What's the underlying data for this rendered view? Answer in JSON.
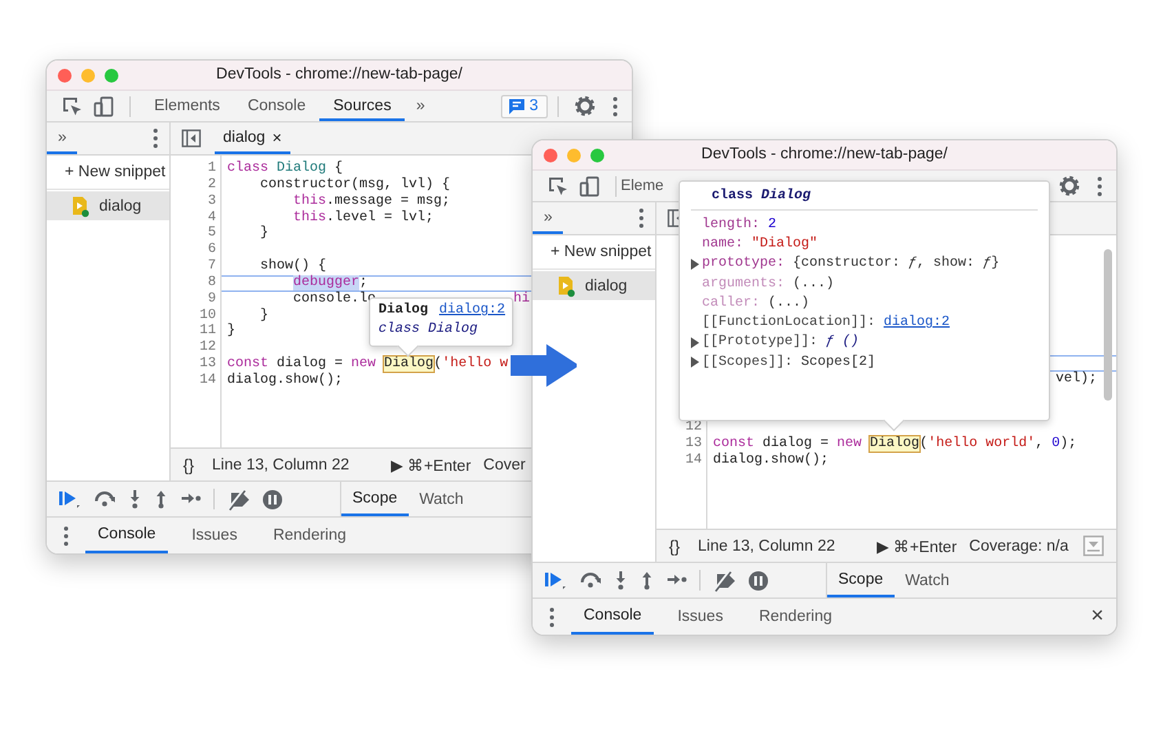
{
  "windows": [
    {
      "title": "DevTools - chrome://new-tab-page/",
      "toolbar": {
        "tabs": [
          {
            "label": "Elements",
            "selected": false
          },
          {
            "label": "Console",
            "selected": false
          },
          {
            "label": "Sources",
            "selected": true
          }
        ],
        "more": "»",
        "issues_badge": "3"
      },
      "navigator": {
        "tabs": [
          {
            "label": "»",
            "selected": true
          }
        ],
        "new_snippet": "+ New snippet",
        "files": [
          {
            "name": "dialog",
            "selected": true
          }
        ]
      },
      "editor_tabs": [
        {
          "label": "dialog",
          "selected": true,
          "close": "×"
        }
      ],
      "code_lines": [
        {
          "number": "1",
          "highlighted": false,
          "tokens": [
            {
              "text": "class",
              "kind": "keyword"
            },
            {
              "text": " Dialog",
              "kind": "class"
            },
            {
              "text": " {",
              "kind": "plain"
            }
          ]
        },
        {
          "number": "2",
          "highlighted": false,
          "tokens": [
            {
              "text": "    constructor(msg, lvl) {",
              "kind": "plain"
            }
          ]
        },
        {
          "number": "3",
          "highlighted": false,
          "tokens": [
            {
              "text": "        this",
              "kind": "keyword"
            },
            {
              "text": ".message = msg;",
              "kind": "plain"
            }
          ]
        },
        {
          "number": "4",
          "highlighted": false,
          "tokens": [
            {
              "text": "        this",
              "kind": "keyword"
            },
            {
              "text": ".level = lvl;",
              "kind": "plain"
            }
          ]
        },
        {
          "number": "5",
          "highlighted": false,
          "tokens": [
            {
              "text": "    }",
              "kind": "plain"
            }
          ]
        },
        {
          "number": "6",
          "highlighted": false
        },
        {
          "number": "7",
          "highlighted": false,
          "tokens": [
            {
              "text": "    show() {",
              "kind": "plain"
            }
          ]
        },
        {
          "number": "8",
          "highlighted": true,
          "tokens": [
            {
              "text": "        debugger",
              "kind": "selection"
            },
            {
              "text": ";",
              "kind": "plain"
            }
          ]
        },
        {
          "number": "9",
          "highlighted": false,
          "tokens": [
            {
              "text": "        console.lo",
              "kind": "plain"
            },
            {
              "text": "hi",
              "kind": "keyword",
              "after_covered": true
            }
          ]
        },
        {
          "number": "10",
          "highlighted": false,
          "tokens": [
            {
              "text": "    }",
              "kind": "plain"
            }
          ]
        },
        {
          "number": "11",
          "highlighted": false,
          "tokens": [
            {
              "text": "}",
              "kind": "plain"
            }
          ]
        },
        {
          "number": "12",
          "highlighted": false
        },
        {
          "number": "13",
          "highlighted": false,
          "tokens": [
            {
              "text": "const",
              "kind": "keyword"
            },
            {
              "text": " dialog = ",
              "kind": "plain"
            },
            {
              "text": "new ",
              "kind": "keyword"
            },
            {
              "text": "Dialog",
              "kind": "hover"
            },
            {
              "text": "(",
              "kind": "plain"
            },
            {
              "text": "'hello w",
              "kind": "string"
            }
          ]
        },
        {
          "number": "14",
          "highlighted": false,
          "tokens": [
            {
              "text": "dialog.show();",
              "kind": "plain"
            }
          ]
        }
      ],
      "status": {
        "format": "{}",
        "position": "Line 13, Column 22",
        "run": "▶ ⌘+Enter",
        "coverage": "Cover"
      },
      "debugger": {
        "tabs": [
          {
            "label": "Scope",
            "selected": true
          },
          {
            "label": "Watch",
            "selected": false
          }
        ]
      },
      "drawer": {
        "tabs": [
          {
            "label": "Console",
            "selected": true
          },
          {
            "label": "Issues",
            "selected": false
          },
          {
            "label": "Rendering",
            "selected": false
          }
        ]
      },
      "popover": {
        "kind": "brief",
        "title": "Dialog",
        "link": "dialog:2",
        "subtitle": "class Dialog"
      }
    },
    {
      "title": "DevTools - chrome://new-tab-page/",
      "toolbar": {
        "tabs": [
          {
            "label": "Eleme",
            "selected": false
          }
        ]
      },
      "navigator": {
        "tabs": [
          {
            "label": "»",
            "selected": true
          }
        ],
        "new_snippet": "+ New snippet",
        "files": [
          {
            "name": "dialog",
            "selected": true
          }
        ]
      },
      "code_lines": [
        {
          "highlighted": false
        },
        {
          "highlighted": false
        },
        {
          "highlighted": false
        },
        {
          "highlighted": false
        },
        {
          "highlighted": false
        },
        {
          "highlighted": false
        },
        {
          "highlighted": false
        },
        {
          "highlighted": true
        },
        {
          "highlighted": false,
          "tokens": [
            {
              "text": "vel);",
              "kind": "plain",
              "after_covered": true
            }
          ]
        },
        {
          "highlighted": false
        },
        {
          "highlighted": false
        },
        {
          "number": "12",
          "highlighted": false
        },
        {
          "number": "13",
          "highlighted": false,
          "tokens": [
            {
              "text": "const",
              "kind": "keyword"
            },
            {
              "text": " dialog = ",
              "kind": "plain"
            },
            {
              "text": "new ",
              "kind": "keyword"
            },
            {
              "text": "Dialog",
              "kind": "hover"
            },
            {
              "text": "(",
              "kind": "plain"
            },
            {
              "text": "'hello world'",
              "kind": "string"
            },
            {
              "text": ", ",
              "kind": "plain"
            },
            {
              "text": "0",
              "kind": "number"
            },
            {
              "text": ");",
              "kind": "plain"
            }
          ]
        },
        {
          "number": "14",
          "highlighted": false,
          "tokens": [
            {
              "text": "dialog.show();",
              "kind": "plain"
            }
          ]
        }
      ],
      "scrollbar": true,
      "status": {
        "format": "{}",
        "position": "Line 13, Column 22",
        "run": "▶ ⌘+Enter",
        "coverage": "Coverage: n/a",
        "panel_icon": true
      },
      "debugger": {
        "tabs": [
          {
            "label": "Scope",
            "selected": true
          },
          {
            "label": "Watch",
            "selected": false
          }
        ]
      },
      "drawer": {
        "tabs": [
          {
            "label": "Console",
            "selected": true
          },
          {
            "label": "Issues",
            "selected": false
          },
          {
            "label": "Rendering",
            "selected": false
          }
        ],
        "close": "×"
      },
      "popover": {
        "kind": "object",
        "header": "class *Dialog*",
        "properties": [
          {
            "key": "length:",
            "value": "2",
            "kind": "number",
            "expandable": false
          },
          {
            "key": "name:",
            "value": "\"Dialog\"",
            "kind": "string",
            "expandable": false
          },
          {
            "key": "prototype:",
            "value": "{constructor: *ƒ*, show: *ƒ*}",
            "kind": "object",
            "expandable": true
          },
          {
            "key": "arguments:",
            "value": "(...)",
            "kind": "accessor",
            "expandable": false
          },
          {
            "key": "caller:",
            "value": "(...)",
            "kind": "accessor",
            "expandable": false
          },
          {
            "key": "[[FunctionLocation]]:",
            "value": "dialog:2",
            "kind": "location",
            "expandable": false
          },
          {
            "key": "[[Prototype]]:",
            "value": "ƒ ()",
            "kind": "function",
            "expandable": true
          },
          {
            "key": "[[Scopes]]:",
            "value": "Scopes[2]",
            "kind": "internal",
            "expandable": true
          }
        ]
      }
    }
  ]
}
